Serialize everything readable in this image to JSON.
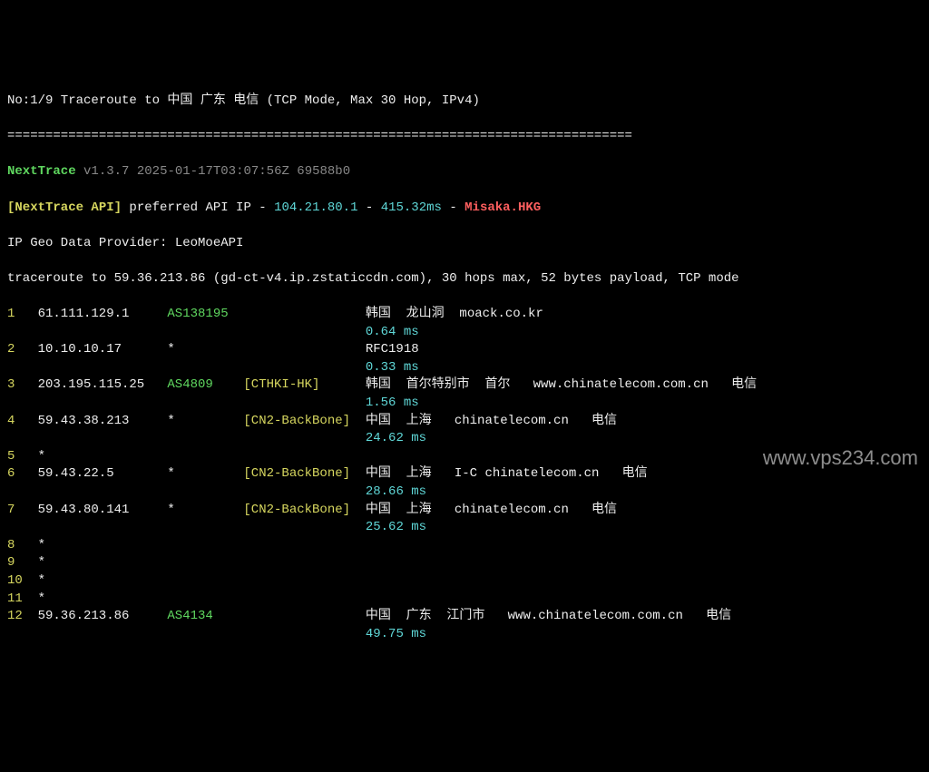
{
  "header": {
    "title": "No:1/9 Traceroute to 中国 广东 电信 (TCP Mode, Max 30 Hop, IPv4)",
    "sep": "==================================================================================",
    "app": "NextTrace",
    "version": "v1.3.7",
    "ts": "2025-01-17T03:07:56Z",
    "build": "69588b0",
    "api_label": "[NextTrace API]",
    "api_text": " preferred API IP - ",
    "api_ip": "104.21.80.1",
    "api_sep": " - ",
    "api_ms": "415.32ms",
    "api_sep2": " - ",
    "api_loc": "Misaka.HKG",
    "geo": "IP Geo Data Provider: LeoMoeAPI",
    "trace": "traceroute to 59.36.213.86 (gd-ct-v4.ip.zstaticcdn.com), 30 hops max, 52 bytes payload, TCP mode"
  },
  "hops": [
    {
      "n": "1",
      "ip": "61.111.129.1",
      "asn": "AS138195",
      "tag": "",
      "info": "韩国  龙山洞  moack.co.kr",
      "ms": "0.64 ms"
    },
    {
      "n": "2",
      "ip": "10.10.10.17",
      "asn": "*",
      "tag": "",
      "info": "RFC1918",
      "ms": "0.33 ms"
    },
    {
      "n": "3",
      "ip": "203.195.115.25",
      "asn": "AS4809",
      "tag": "[CTHKI-HK]",
      "info": "韩国  首尔特别市  首尔   www.chinatelecom.com.cn   电信",
      "ms": "1.56 ms"
    },
    {
      "n": "4",
      "ip": "59.43.38.213",
      "asn": "*",
      "tag": "[CN2-BackBone]",
      "info": "中国  上海   chinatelecom.cn   电信",
      "ms": "24.62 ms"
    },
    {
      "n": "5",
      "ip": "*",
      "asn": "",
      "tag": "",
      "info": "",
      "ms": ""
    },
    {
      "n": "6",
      "ip": "59.43.22.5",
      "asn": "*",
      "tag": "[CN2-BackBone]",
      "info": "中国  上海   I-C chinatelecom.cn   电信",
      "ms": "28.66 ms"
    },
    {
      "n": "7",
      "ip": "59.43.80.141",
      "asn": "*",
      "tag": "[CN2-BackBone]",
      "info": "中国  上海   chinatelecom.cn   电信",
      "ms": "25.62 ms"
    },
    {
      "n": "8",
      "ip": "*",
      "asn": "",
      "tag": "",
      "info": "",
      "ms": ""
    },
    {
      "n": "9",
      "ip": "*",
      "asn": "",
      "tag": "",
      "info": "",
      "ms": ""
    },
    {
      "n": "10",
      "ip": "*",
      "asn": "",
      "tag": "",
      "info": "",
      "ms": ""
    },
    {
      "n": "11",
      "ip": "*",
      "asn": "",
      "tag": "",
      "info": "",
      "ms": ""
    },
    {
      "n": "12",
      "ip": "59.36.213.86",
      "asn": "AS4134",
      "tag": "",
      "info": "中国  广东  江门市   www.chinatelecom.com.cn   电信",
      "ms": "49.75 ms"
    }
  ],
  "watermark": "www.vps234.com"
}
